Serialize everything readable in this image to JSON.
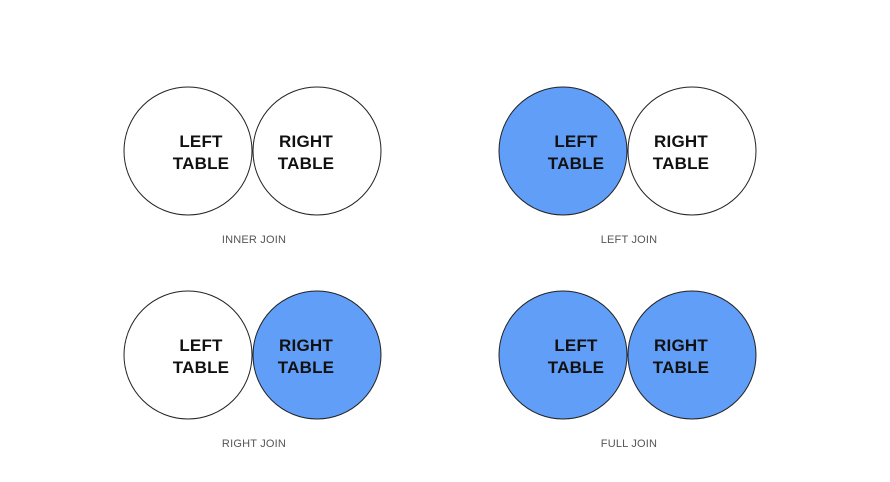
{
  "labels": {
    "left_line1": "LEFT",
    "left_line2": "TABLE",
    "right_line1": "RIGHT",
    "right_line2": "TABLE"
  },
  "colors": {
    "fill": "#619ef7",
    "stroke": "#222222",
    "background": "#ffffff"
  },
  "diagrams": [
    {
      "caption": "INNER JOIN",
      "shade": "intersection"
    },
    {
      "caption": "LEFT JOIN",
      "shade": "left"
    },
    {
      "caption": "RIGHT JOIN",
      "shade": "right"
    },
    {
      "caption": "FULL JOIN",
      "shade": "both"
    }
  ]
}
